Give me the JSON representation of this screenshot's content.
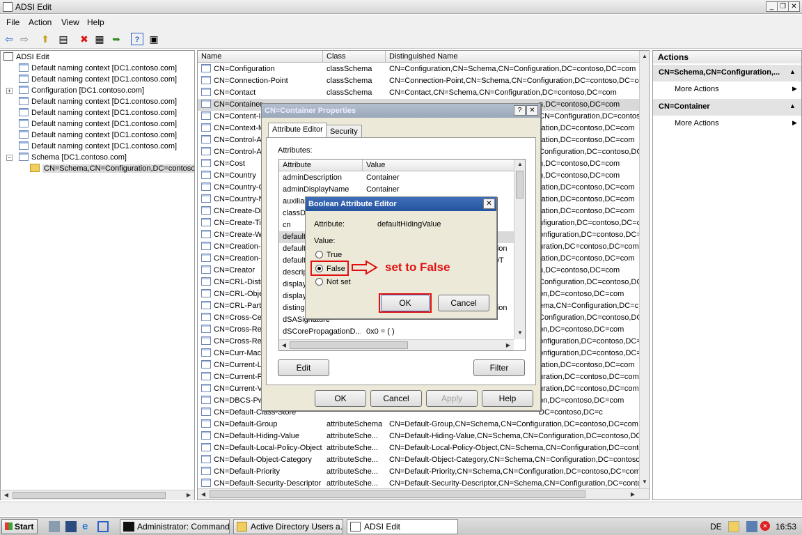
{
  "window": {
    "title": "ADSI Edit"
  },
  "menu": [
    "File",
    "Action",
    "View",
    "Help"
  ],
  "tree": {
    "root": "ADSI Edit",
    "items": [
      "Default naming context [DC1.contoso.com]",
      "Default naming context [DC1.contoso.com]",
      "Configuration [DC1.contoso.com]",
      "Default naming context [DC1.contoso.com]",
      "Default naming context [DC1.contoso.com]",
      "Default naming context [DC1.contoso.com]",
      "Default naming context [DC1.contoso.com]",
      "Default naming context [DC1.contoso.com]",
      "Schema [DC1.contoso.com]",
      "CN=Schema,CN=Configuration,DC=contoso"
    ]
  },
  "list": {
    "columns": [
      "Name",
      "Class",
      "Distinguished Name"
    ],
    "rows": [
      [
        "CN=Configuration",
        "classSchema",
        "CN=Configuration,CN=Schema,CN=Configuration,DC=contoso,DC=com"
      ],
      [
        "CN=Connection-Point",
        "classSchema",
        "CN=Connection-Point,CN=Schema,CN=Configuration,DC=contoso,DC=com"
      ],
      [
        "CN=Contact",
        "classSchema",
        "CN=Contact,CN=Schema,CN=Configuration,DC=contoso,DC=com"
      ],
      [
        "CN=Container",
        "",
        "n,DC=contoso,DC=com"
      ],
      [
        "CN=Content-I",
        "",
        "CN=Configuration,DC=contos"
      ],
      [
        "CN=Context-M",
        "",
        "ration,DC=contoso,DC=com"
      ],
      [
        "CN=Control-A",
        "",
        "ration,DC=contoso,DC=com"
      ],
      [
        "CN=Control-A",
        "",
        "Configuration,DC=contoso,DC"
      ],
      [
        "CN=Cost",
        "",
        "n,DC=contoso,DC=com"
      ],
      [
        "CN=Country",
        "",
        "n,DC=contoso,DC=com"
      ],
      [
        "CN=Country-C",
        "",
        "ration,DC=contoso,DC=com"
      ],
      [
        "CN=Country-N",
        "",
        "ration,DC=contoso,DC=com"
      ],
      [
        "CN=Create-Di",
        "",
        "ration,DC=contoso,DC=com"
      ],
      [
        "CN=Create-Tir",
        "",
        "nfiguration,DC=contoso,DC=c"
      ],
      [
        "CN=Create-W",
        "",
        "onfiguration,DC=contoso,DC="
      ],
      [
        "CN=Creation-",
        "",
        "uration,DC=contoso,DC=com"
      ],
      [
        "CN=Creation-",
        "",
        "ration,DC=contoso,DC=com"
      ],
      [
        "CN=Creator",
        "",
        "n,DC=contoso,DC=com"
      ],
      [
        "CN=CRL-Distri",
        "",
        "Configuration,DC=contoso,DC"
      ],
      [
        "CN=CRL-Obje",
        "",
        "on,DC=contoso,DC=com"
      ],
      [
        "CN=CRL-Partit",
        "",
        "ema,CN=Configuration,DC=c"
      ],
      [
        "CN=Cross-Cer",
        "",
        "Configuration,DC=contoso,DC"
      ],
      [
        "CN=Cross-Ref",
        "",
        "on,DC=contoso,DC=com"
      ],
      [
        "CN=Cross-Ref",
        "",
        "onfiguration,DC=contoso,DC="
      ],
      [
        "CN=Curr-Mach",
        "",
        "onfiguration,DC=contoso,DC="
      ],
      [
        "CN=Current-L",
        "",
        "ration,DC=contoso,DC=com"
      ],
      [
        "CN=Current-P",
        "",
        "uration,DC=contoso,DC=com"
      ],
      [
        "CN=Current-V",
        "",
        "uration,DC=contoso,DC=com"
      ],
      [
        "CN=DBCS-Pwo",
        "",
        "on,DC=contoso,DC=com"
      ],
      [
        "CN=Default-Class-Store",
        "",
        "DC=contoso,DC=c"
      ],
      [
        "CN=Default-Group",
        "attributeSchema",
        "CN=Default-Group,CN=Schema,CN=Configuration,DC=contoso,DC=com"
      ],
      [
        "CN=Default-Hiding-Value",
        "attributeSche...",
        "CN=Default-Hiding-Value,CN=Schema,CN=Configuration,DC=contoso,DC"
      ],
      [
        "CN=Default-Local-Policy-Object",
        "attributeSche...",
        "CN=Default-Local-Policy-Object,CN=Schema,CN=Configuration,DC=conto"
      ],
      [
        "CN=Default-Object-Category",
        "attributeSche...",
        "CN=Default-Object-Category,CN=Schema,CN=Configuration,DC=contoso"
      ],
      [
        "CN=Default-Priority",
        "attributeSche...",
        "CN=Default-Priority,CN=Schema,CN=Configuration,DC=contoso,DC=com"
      ],
      [
        "CN=Default-Security-Descriptor",
        "attributeSche...",
        "CN=Default-Security-Descriptor,CN=Schema,CN=Configuration,DC=conto"
      ]
    ]
  },
  "actions": {
    "title": "Actions",
    "sections": [
      {
        "header": "CN=Schema,CN=Configuration,...",
        "item": "More Actions"
      },
      {
        "header": "CN=Container",
        "item": "More Actions"
      }
    ]
  },
  "props_dialog": {
    "title": "CN=Container Properties",
    "help_btn": "?",
    "tabs": [
      "Attribute Editor",
      "Security"
    ],
    "attributes_label": "Attributes:",
    "columns": [
      "Attribute",
      "Value"
    ],
    "rows": [
      [
        "adminDescription",
        "Container"
      ],
      [
        "adminDisplayName",
        "Container"
      ],
      [
        "auxiliar",
        ""
      ],
      [
        "classD",
        ""
      ],
      [
        "cn",
        ""
      ],
      [
        "default",
        ""
      ],
      [
        "default",
        "ration"
      ],
      [
        "default",
        "DDT"
      ],
      [
        "descrip",
        ""
      ],
      [
        "display",
        ""
      ],
      [
        "display",
        ""
      ],
      [
        "disting",
        "ration"
      ],
      [
        "dSASignature",
        ""
      ],
      [
        "dSCorePropagationD...",
        "0x0 = ( )"
      ]
    ],
    "edit_btn": "Edit",
    "filter_btn": "Filter",
    "ok_btn": "OK",
    "cancel_btn": "Cancel",
    "apply_btn": "Apply",
    "help_text_btn": "Help"
  },
  "bool_dialog": {
    "title": "Boolean Attribute Editor",
    "attribute_label": "Attribute:",
    "attribute_value": "defaultHidingValue",
    "value_label": "Value:",
    "options": [
      "True",
      "False",
      "Not set"
    ],
    "selected": "False",
    "ok": "OK",
    "cancel": "Cancel"
  },
  "annotation": {
    "text": "set to False",
    "color": "#e01010"
  },
  "taskbar": {
    "start": "Start",
    "tasks": [
      "Administrator: Command...",
      "Active Directory Users a...",
      "ADSI Edit"
    ],
    "lang": "DE",
    "time": "16:53"
  }
}
